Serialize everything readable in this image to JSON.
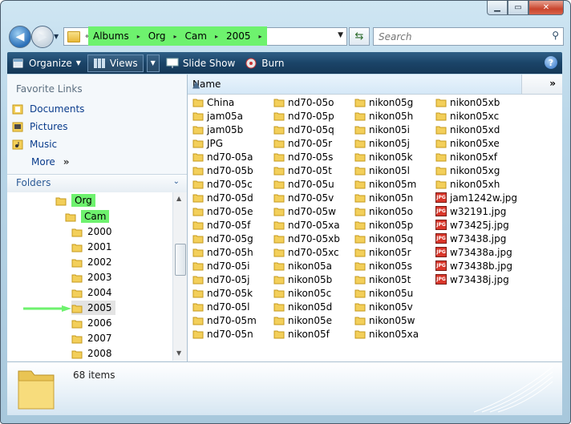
{
  "address": {
    "chevron": "«",
    "crumbs": [
      "Albums",
      "Org",
      "Cam",
      "2005"
    ],
    "separator": "▸"
  },
  "search": {
    "placeholder": "Search"
  },
  "toolbar": {
    "organize": "Organize",
    "views": "Views",
    "slideshow": "Slide Show",
    "burn": "Burn",
    "help": "?"
  },
  "favorites": {
    "title": "Favorite Links",
    "items": [
      "Documents",
      "Pictures",
      "Music",
      "More"
    ],
    "more_arrows": "»"
  },
  "folders": {
    "title": "Folders",
    "tree": [
      "Org",
      "Cam",
      "2000",
      "2001",
      "2002",
      "2003",
      "2004",
      "2005",
      "2006",
      "2007",
      "2008"
    ],
    "highlighted": [
      "Org",
      "Cam"
    ],
    "selected": "2005"
  },
  "columns": {
    "name": "Name",
    "more": "»"
  },
  "files": {
    "col1": [
      "China",
      "jam05a",
      "jam05b",
      "JPG",
      "nd70-05a",
      "nd70-05b",
      "nd70-05c",
      "nd70-05d",
      "nd70-05e",
      "nd70-05f",
      "nd70-05g",
      "nd70-05h",
      "nd70-05i",
      "nd70-05j",
      "nd70-05k",
      "nd70-05l",
      "nd70-05m",
      "nd70-05n"
    ],
    "col2": [
      "nd70-05o",
      "nd70-05p",
      "nd70-05q",
      "nd70-05r",
      "nd70-05s",
      "nd70-05t",
      "nd70-05u",
      "nd70-05v",
      "nd70-05w",
      "nd70-05xa",
      "nd70-05xb",
      "nd70-05xc",
      "nikon05a",
      "nikon05b",
      "nikon05c",
      "nikon05d",
      "nikon05e",
      "nikon05f"
    ],
    "col3": [
      "nikon05g",
      "nikon05h",
      "nikon05i",
      "nikon05j",
      "nikon05k",
      "nikon05l",
      "nikon05m",
      "nikon05n",
      "nikon05o",
      "nikon05p",
      "nikon05q",
      "nikon05r",
      "nikon05s",
      "nikon05t",
      "nikon05u",
      "nikon05v",
      "nikon05w",
      "nikon05xa"
    ],
    "col4": [
      "nikon05xb",
      "nikon05xc",
      "nikon05xd",
      "nikon05xe",
      "nikon05xf",
      "nikon05xg",
      "nikon05xh",
      "jam1242w.jpg",
      "w32191.jpg",
      "w73425j.jpg",
      "w73438.jpg",
      "w73438a.jpg",
      "w73438b.jpg",
      "w73438j.jpg"
    ],
    "col4_types": [
      "folder",
      "folder",
      "folder",
      "folder",
      "folder",
      "folder",
      "folder",
      "jpg",
      "jpg",
      "jpg",
      "jpg",
      "jpg",
      "jpg",
      "jpg"
    ],
    "jpg_badge": "JPG"
  },
  "details": {
    "count": "68 items"
  },
  "colors": {
    "highlight": "#6ef26e",
    "link": "#0a3c8c",
    "toolbar": "#1b4468"
  }
}
